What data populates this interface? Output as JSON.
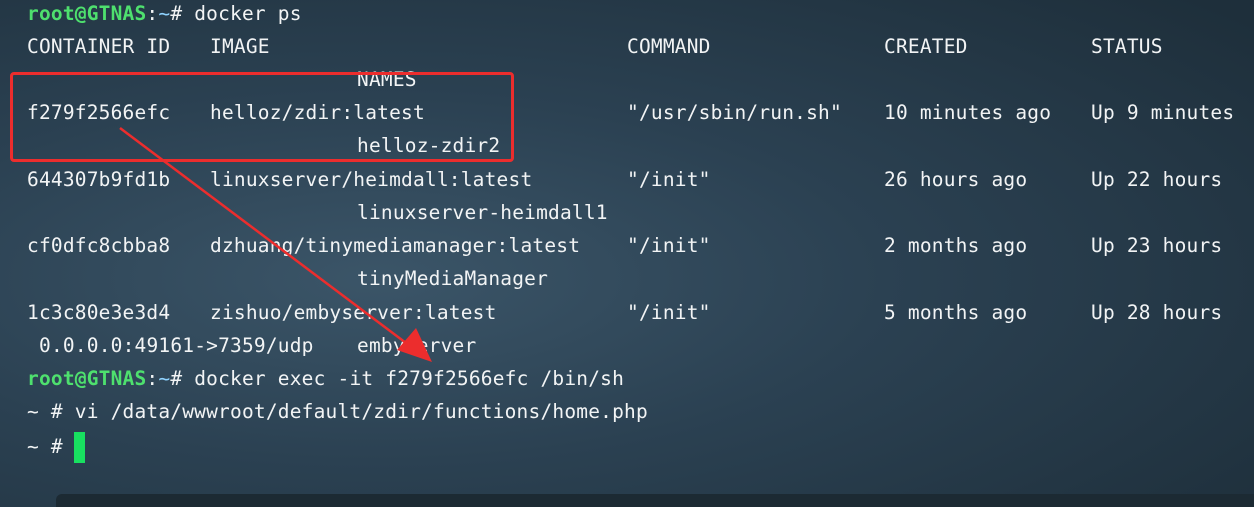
{
  "prompt": {
    "user_host": "root@GTNAS",
    "separator": ":",
    "path": "~",
    "symbol": "#"
  },
  "commands": {
    "docker_ps": "docker ps",
    "docker_exec": "docker exec -it f279f2566efc /bin/sh",
    "vi": "vi /data/wwwroot/default/zdir/functions/home.php"
  },
  "shell_prompt": "~ #",
  "headers": {
    "container_id": "CONTAINER ID",
    "image": "IMAGE",
    "command": "COMMAND",
    "created": "CREATED",
    "status": "STATUS",
    "names": "NAMES"
  },
  "rows": [
    {
      "id": "f279f2566efc",
      "image": "helloz/zdir:latest",
      "command": "\"/usr/sbin/run.sh\"",
      "created": "10 minutes ago",
      "status": "Up 9 minutes",
      "names": "helloz-zdir2"
    },
    {
      "id": "644307b9fd1b",
      "image": "linuxserver/heimdall:latest",
      "command": "\"/init\"",
      "created": "26 hours ago",
      "status": "Up 22 hours",
      "names": "linuxserver-heimdall1"
    },
    {
      "id": "cf0dfc8cbba8",
      "image": "dzhuang/tinymediamanager:latest",
      "command": "\"/init\"",
      "created": "2 months ago",
      "status": "Up 23 hours",
      "names": "tinyMediaManager"
    },
    {
      "id": "1c3c80e3e3d4",
      "image": "zishuo/embyserver:latest",
      "command": "\"/init\"",
      "created": "5 months ago",
      "status": "Up 28 hours",
      "names": "embyserver",
      "ports": "0.0.0.0:49161->7359/udp"
    }
  ],
  "colors": {
    "background": "#2b4152",
    "prompt_user": "#4ee06e",
    "prompt_path": "#8fd3ff",
    "cursor": "#18e060",
    "annotation": "#ec2d2d"
  }
}
